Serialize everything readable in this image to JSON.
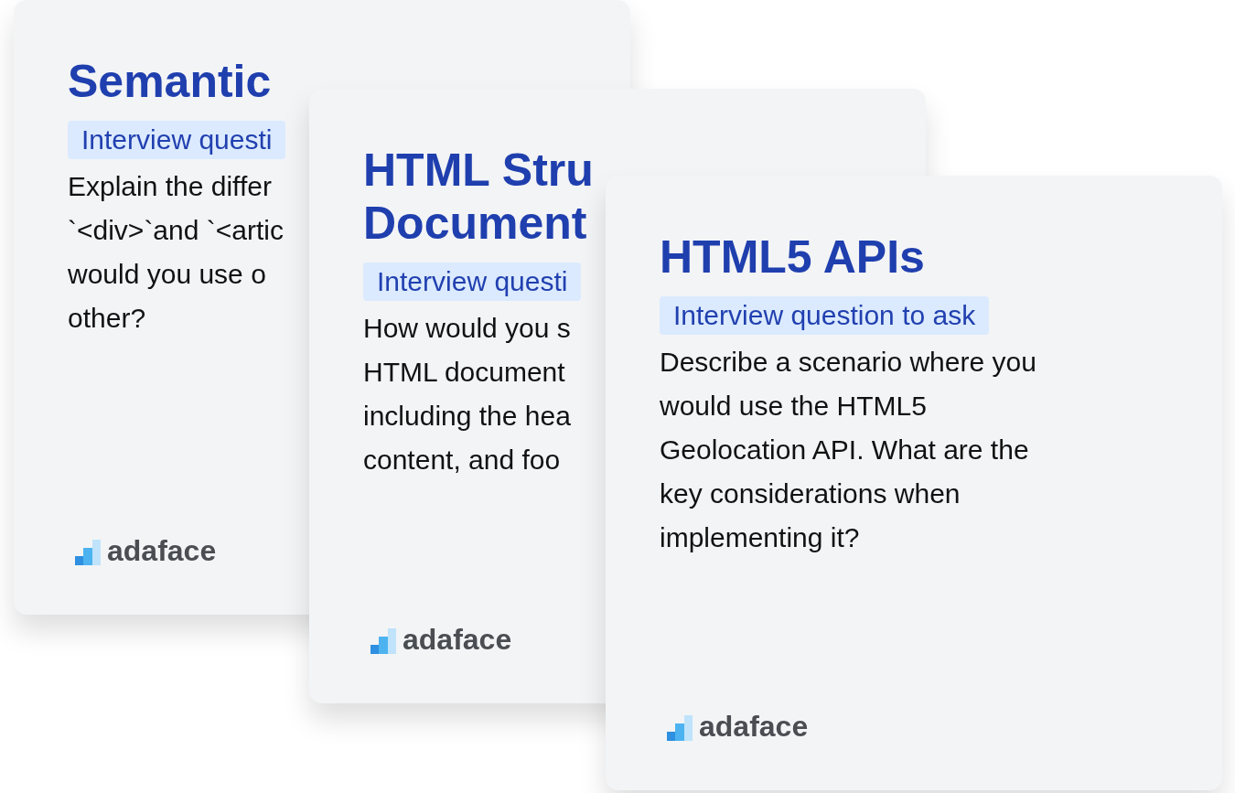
{
  "cards": [
    {
      "title_lines": [
        "Semantic"
      ],
      "badge": "Interview questi",
      "body_lines": [
        "Explain the differ",
        "`<div>`and `<artic",
        "would you use o",
        "other?"
      ],
      "logo": "adaface"
    },
    {
      "title_lines": [
        "HTML Stru",
        "Document"
      ],
      "badge": "Interview questi",
      "body_lines": [
        "How would you s",
        "HTML document",
        "including the hea",
        "content, and foo"
      ],
      "logo": "adaface"
    },
    {
      "title_lines": [
        "HTML5 APIs"
      ],
      "badge": "Interview question to ask",
      "body_lines": [
        "Describe a scenario where you",
        "would use the HTML5",
        "Geolocation API. What are the",
        "key considerations when",
        "implementing it?"
      ],
      "logo": "adaface"
    }
  ]
}
